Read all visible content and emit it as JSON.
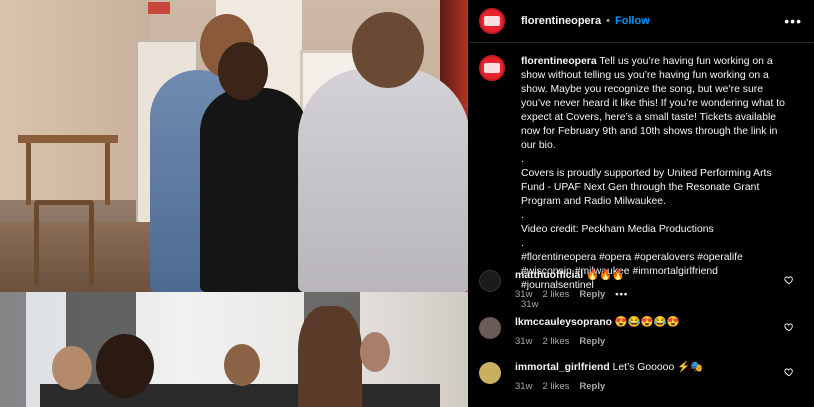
{
  "post": {
    "username": "florentineopera",
    "dot": "•",
    "follow_label": "Follow",
    "more_label": "•••",
    "caption": {
      "username": "florentineopera",
      "text": " Tell us you’re having fun working on a show without telling us you’re having fun working on a show. Maybe you recognize the song, but we’re sure you’ve never heard it like this! If you’re wondering what to expect at Covers, here’s a small taste! Tickets available now for February 9th and 10th shows through the link in our bio.\n.\nCovers is proudly supported by United Performing Arts Fund - UPAF Next Gen through the Resonate Grant Program and Radio Milwaukee.\n.\nVideo credit: Peckham Media Productions\n.\n#florentineopera #opera #operalovers #operalife #wisconsin #milwaukee #immortalgirlfriend #journalsentinel",
      "age": "31w"
    }
  },
  "comments": [
    {
      "username": "matthuofficial",
      "text": "🔥🔥🔥",
      "age": "31w",
      "likes": "2 likes",
      "reply_label": "Reply",
      "more_label": "•••",
      "avatar_color": "#1b1b1b"
    },
    {
      "username": "lkmccauleysoprano",
      "text": "😍😂😍😂😍",
      "age": "31w",
      "likes": "2 likes",
      "reply_label": "Reply",
      "avatar_color": "#6b5a55"
    },
    {
      "username": "immortal_girlfriend",
      "text": "Let’s Gooooo ⚡🎭",
      "age": "31w",
      "likes": "2 likes",
      "reply_label": "Reply",
      "avatar_color": "#c8b060"
    }
  ],
  "colors": {
    "brand_red": "#e8232f",
    "link_blue": "#0095f6",
    "muted_text": "#a8a8a8"
  },
  "icons": {
    "more": "more-horizontal-icon",
    "like": "heart-outline-icon"
  }
}
